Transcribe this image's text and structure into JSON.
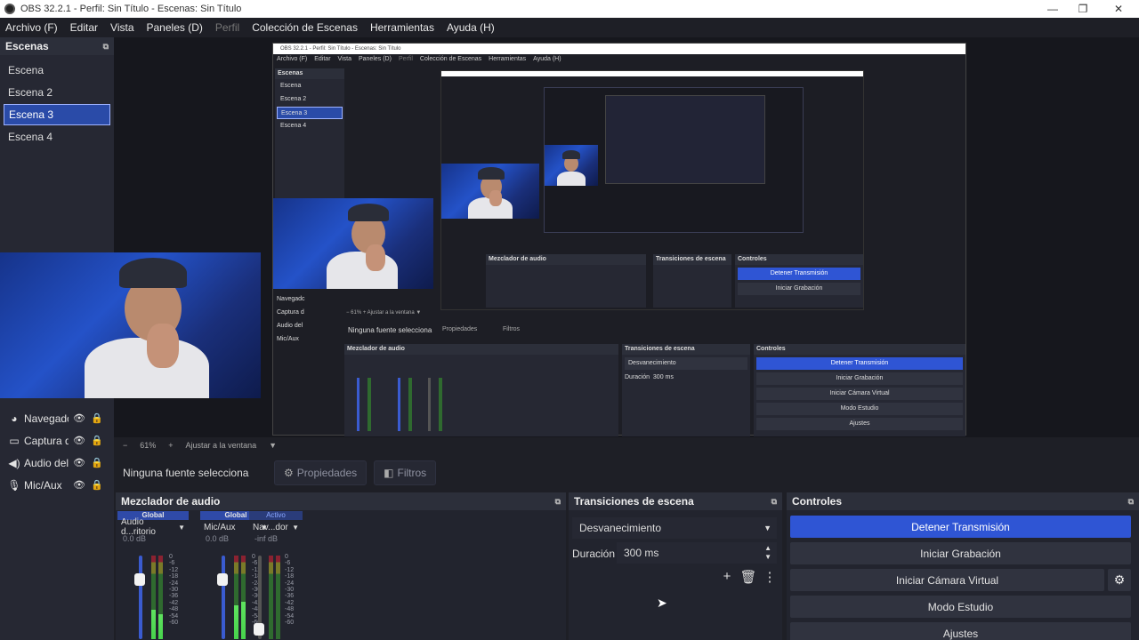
{
  "window": {
    "title": "OBS 32.2.1 - Perfil: Sin Título - Escenas: Sin Título",
    "minimize": "—",
    "maximize": "❐",
    "close": "✕"
  },
  "menu": [
    {
      "label": "Archivo (F)",
      "disabled": false
    },
    {
      "label": "Editar",
      "disabled": false
    },
    {
      "label": "Vista",
      "disabled": false
    },
    {
      "label": "Paneles (D)",
      "disabled": false
    },
    {
      "label": "Perfil",
      "disabled": true
    },
    {
      "label": "Colección de Escenas",
      "disabled": false
    },
    {
      "label": "Herramientas",
      "disabled": false
    },
    {
      "label": "Ayuda (H)",
      "disabled": false
    }
  ],
  "scenes": {
    "title": "Escenas",
    "items": [
      "Escena",
      "Escena 2",
      "Escena 3",
      "Escena 4"
    ],
    "selected": "Escena 3"
  },
  "sources": {
    "items": [
      {
        "icon": "globe-icon",
        "glyph": "◕",
        "label": "Navegadc"
      },
      {
        "icon": "monitor-icon",
        "glyph": "▭",
        "label": "Captura d"
      },
      {
        "icon": "speaker-icon",
        "glyph": "◀)",
        "label": "Audio del"
      },
      {
        "icon": "mic-icon",
        "glyph": "🎙",
        "label": "Mic/Aux"
      }
    ]
  },
  "zoombar": {
    "minus": "−",
    "zoom": "61%",
    "plus": "+",
    "fit": "Ajustar a la ventana",
    "caret": "▼"
  },
  "context": {
    "no_source": "Ninguna fuente selecciona",
    "properties": "Propiedades",
    "filters": "Filtros"
  },
  "mixer": {
    "title": "Mezclador de audio",
    "channels": [
      {
        "tag": "Global",
        "name": "Audio d...ritorio",
        "db": "0.0 dB",
        "level": 0.35
      },
      {
        "tag": "Global",
        "name": "Mic/Aux",
        "db": "0.0 dB",
        "level": 0.4
      },
      {
        "tag": "Activo",
        "name": "Nav...dor",
        "db": "-inf dB",
        "level": 0.0
      }
    ],
    "scale": [
      "0",
      "-6",
      "-12",
      "-18",
      "-24",
      "-30",
      "-36",
      "-42",
      "-48",
      "-54",
      "-60"
    ]
  },
  "transitions": {
    "title": "Transiciones de escena",
    "selected": "Desvanecimiento",
    "duration_label": "Duración",
    "duration": "300 ms"
  },
  "controls": {
    "title": "Controles",
    "buttons": [
      "Detener Transmisión",
      "Iniciar Grabación",
      "Iniciar Cámara Virtual",
      "Modo Estudio",
      "Ajustes"
    ]
  },
  "nested": {
    "title": "OBS 32.2.1 - Perfil: Sin Título - Escenas: Sin Título",
    "menu": [
      "Archivo (F)",
      "Editar",
      "Vista",
      "Paneles (D)",
      "Perfil",
      "Colección de Escenas",
      "Herramientas",
      "Ayuda (H)"
    ],
    "scenes_title": "Escenas",
    "scenes": [
      "Escena",
      "Escena 2",
      "Escena 3",
      "Escena 4"
    ],
    "sources": [
      "Navegadc",
      "Captura d",
      "Audio del",
      "Mic/Aux"
    ],
    "zoom": "−    61%    +    Ajustar a la ventana  ▼",
    "no_source": "Ninguna fuente selecciona",
    "properties": "Propiedades",
    "filters": "Filtros",
    "mixer_title": "Mezclador de audio",
    "trans_title": "Transiciones de escena",
    "trans_selected": "Desvanecimiento",
    "duration_label": "Duración",
    "duration": "300 ms",
    "controls_title": "Controles",
    "buttons": [
      "Detener Transmisión",
      "Iniciar Grabación",
      "Iniciar Cámara Virtual",
      "Modo Estudio",
      "Ajustes"
    ]
  },
  "colors": {
    "accent": "#2f55d4",
    "panel": "#262833",
    "background": "#1e1f26"
  }
}
